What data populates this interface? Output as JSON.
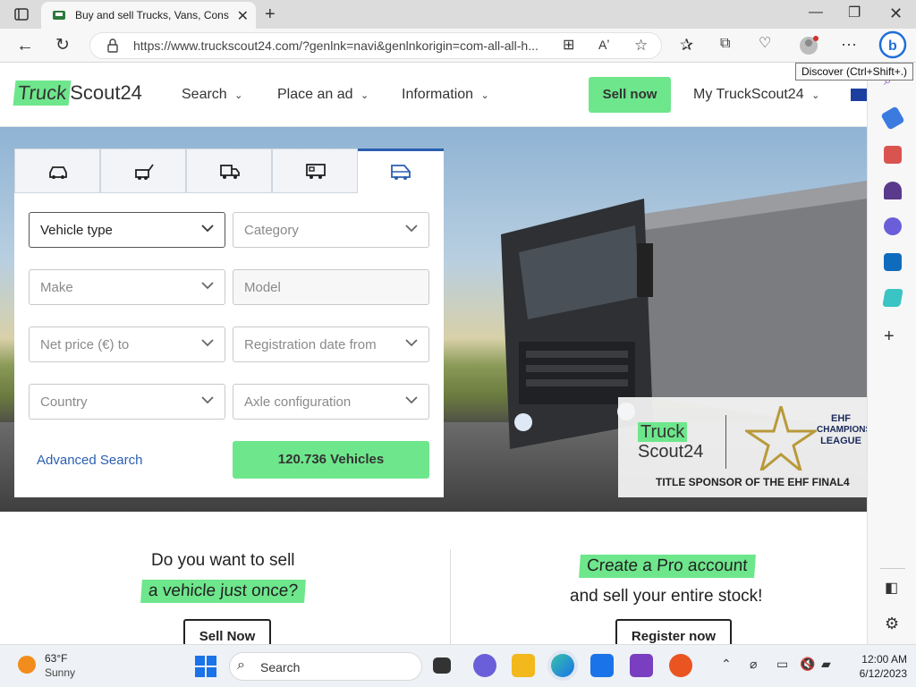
{
  "browser": {
    "tab_title": "Buy and sell Trucks, Vans, Constr",
    "url": "https://www.truckscout24.com/?genlnk=navi&genlnkorigin=com-all-all-h...",
    "tooltip": "Discover (Ctrl+Shift+.)"
  },
  "site": {
    "logo_truck": "Truck",
    "logo_scout": "Scout24",
    "nav": {
      "search": "Search",
      "place_ad": "Place an ad",
      "information": "Information",
      "sell_now": "Sell now",
      "my_account": "My TruckScout24"
    }
  },
  "search_panel": {
    "fields": {
      "vehicle_type": "Vehicle type",
      "category": "Category",
      "make": "Make",
      "model": "Model",
      "net_price": "Net price (€) to",
      "registration_date": "Registration date from",
      "country": "Country",
      "axle_configuration": "Axle configuration"
    },
    "advanced_search": "Advanced Search",
    "results_button": "120.736 Vehicles"
  },
  "sponsor": {
    "logo_truck": "Truck",
    "logo_scout": "Scout24",
    "ehf": "EHF",
    "champions": "CHAMPIONS",
    "league": "LEAGUE",
    "caption": "TITLE SPONSOR OF THE EHF FINAL4"
  },
  "promo_left": {
    "line1": "Do you want to sell",
    "line2": "a vehicle just once?",
    "button": "Sell Now"
  },
  "promo_right": {
    "line1": "Create a Pro account",
    "line2": "and sell your entire stock!",
    "button": "Register now"
  },
  "taskbar": {
    "weather_temp": "63°F",
    "weather_desc": "Sunny",
    "search_label": "Search",
    "time": "12:00 AM",
    "date": "6/12/2023"
  },
  "colors": {
    "brand_green": "#6ee68c",
    "link_blue": "#2a5fb0"
  }
}
